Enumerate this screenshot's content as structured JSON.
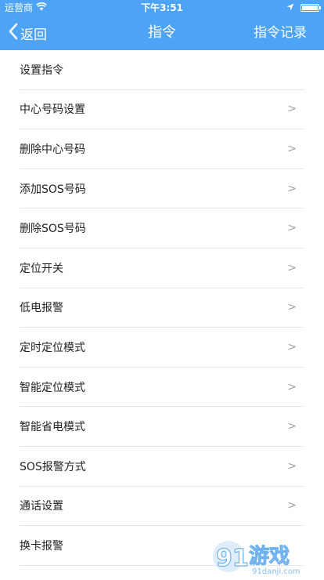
{
  "status_bar": {
    "carrier": "运营商",
    "time": "下午3:51",
    "battery_level": 1.0
  },
  "nav": {
    "back_label": "返回",
    "title": "指令",
    "right_label": "指令记录"
  },
  "list": {
    "items": [
      {
        "label": "设置指令",
        "arrow": ""
      },
      {
        "label": "中心号码设置",
        "arrow": ">"
      },
      {
        "label": "删除中心号码",
        "arrow": ">"
      },
      {
        "label": "添加SOS号码",
        "arrow": ">"
      },
      {
        "label": "删除SOS号码",
        "arrow": ">"
      },
      {
        "label": "定位开关",
        "arrow": ">"
      },
      {
        "label": "低电报警",
        "arrow": ">"
      },
      {
        "label": "定时定位模式",
        "arrow": ">"
      },
      {
        "label": "智能定位模式",
        "arrow": ">"
      },
      {
        "label": "智能省电模式",
        "arrow": ">"
      },
      {
        "label": "SOS报警方式",
        "arrow": ">"
      },
      {
        "label": "通话设置",
        "arrow": ">"
      },
      {
        "label": "换卡报警",
        "arrow": ""
      }
    ]
  },
  "watermark": {
    "logo_text": "91游戏",
    "url": "91danji.com"
  },
  "colors": {
    "header_bg": "#4da3f5"
  }
}
